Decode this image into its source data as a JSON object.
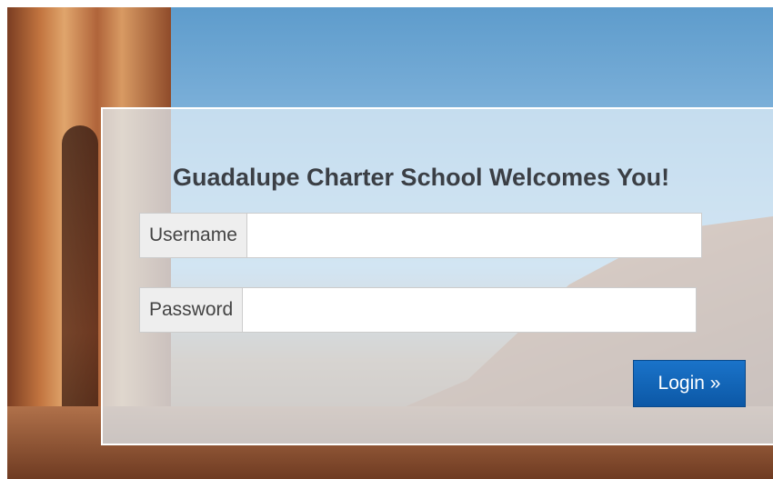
{
  "login": {
    "title": "Guadalupe Charter School Welcomes You!",
    "username_label": "Username",
    "username_value": "",
    "password_label": "Password",
    "password_value": "",
    "login_button": "Login »"
  },
  "colors": {
    "button": "#0c58a6",
    "title_text": "#3b3f45"
  }
}
